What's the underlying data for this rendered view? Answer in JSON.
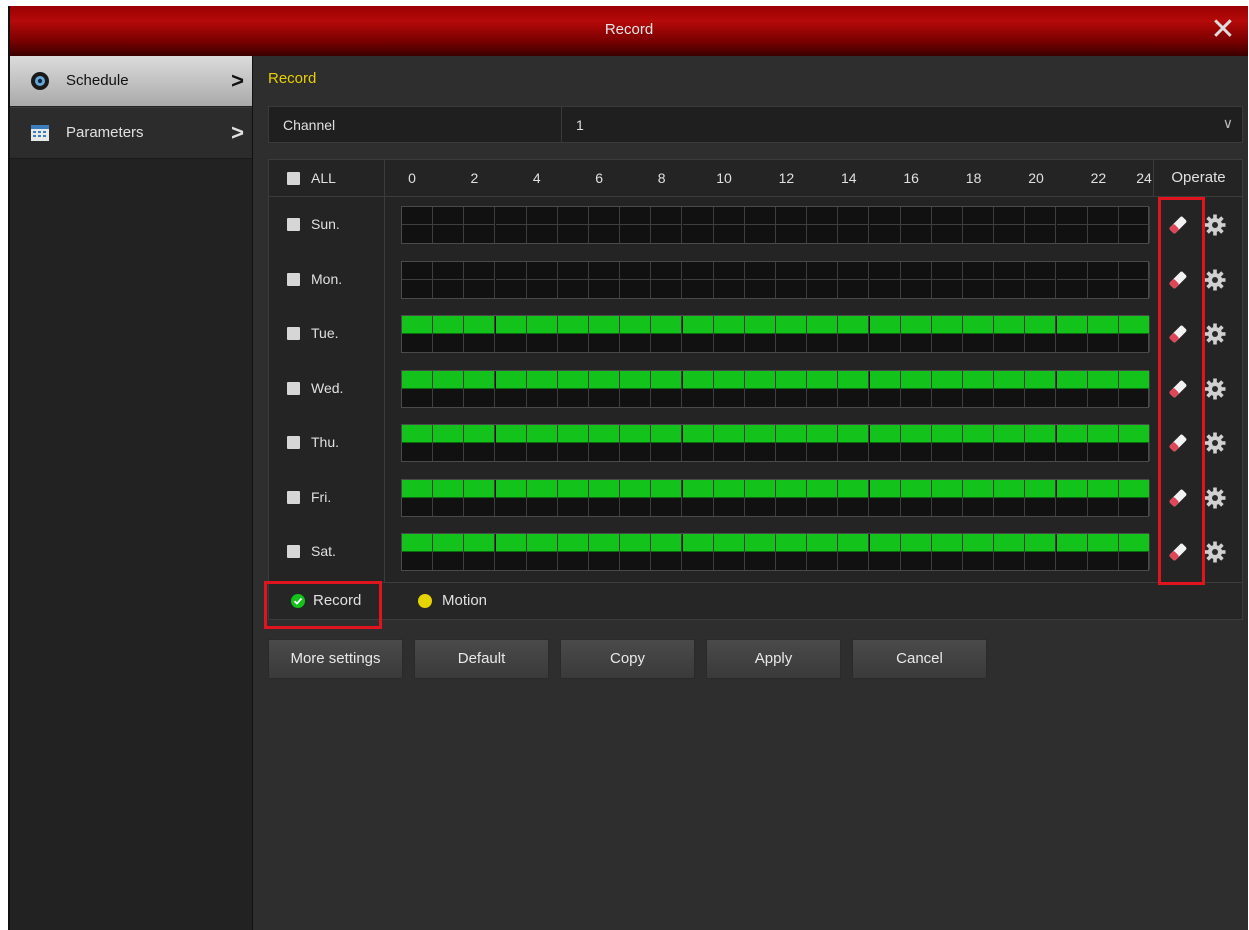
{
  "window": {
    "title": "Record"
  },
  "sidebar": {
    "items": [
      {
        "label": "Schedule",
        "icon": "camera-icon"
      },
      {
        "label": "Parameters",
        "icon": "calendar-icon"
      }
    ]
  },
  "main": {
    "section_title": "Record",
    "channel": {
      "label": "Channel",
      "value": "1"
    },
    "schedule": {
      "all_label": "ALL",
      "hour_labels": [
        "0",
        "2",
        "4",
        "6",
        "8",
        "10",
        "12",
        "14",
        "16",
        "18",
        "20",
        "22",
        "24"
      ],
      "operate_label": "Operate",
      "days": [
        {
          "label": "Sun.",
          "record": false
        },
        {
          "label": "Mon.",
          "record": false
        },
        {
          "label": "Tue.",
          "record": true
        },
        {
          "label": "Wed.",
          "record": true
        },
        {
          "label": "Thu.",
          "record": true
        },
        {
          "label": "Fri.",
          "record": true
        },
        {
          "label": "Sat.",
          "record": true
        }
      ]
    },
    "legend": {
      "record_label": "Record",
      "motion_label": "Motion",
      "record_color": "#13c21a",
      "motion_color": "#e6d400"
    },
    "buttons": {
      "more_settings": "More settings",
      "default": "Default",
      "copy": "Copy",
      "apply": "Apply",
      "cancel": "Cancel"
    }
  },
  "colors": {
    "title_bar": "#b50a0a",
    "section_title": "#e8d000",
    "highlight": "#e0141e"
  }
}
